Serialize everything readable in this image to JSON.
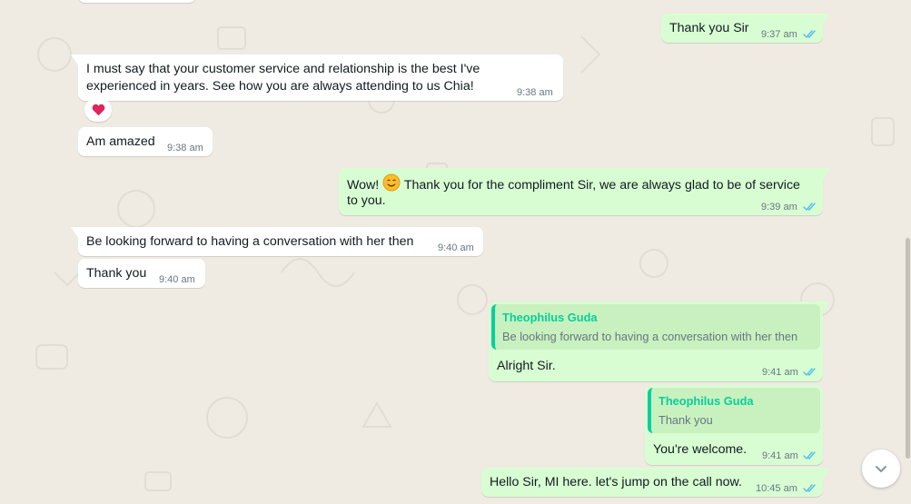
{
  "colors": {
    "chat_background": "#efeae2",
    "incoming_bubble": "#ffffff",
    "outgoing_bubble": "#d9fdd3",
    "quote_background": "#c9f1bf",
    "quote_accent": "#06cf9c",
    "read_ticks": "#53bdeb",
    "timestamp": "#667781",
    "reaction_heart": "#e0245e"
  },
  "messages": [
    {
      "id": "m1",
      "direction": "out",
      "text": "Thank you Sir",
      "time": "9:37 am",
      "status_icon": "double-check-read-icon"
    },
    {
      "id": "m2",
      "direction": "in",
      "text_line1": "I must say that your customer service and relationship is the best I've",
      "text_line2": "experienced in years. See how you are always attending to us Chia!",
      "time": "9:38 am",
      "reaction": "heart-icon"
    },
    {
      "id": "m3",
      "direction": "in",
      "text": "Am amazed",
      "time": "9:38 am"
    },
    {
      "id": "m4",
      "direction": "out",
      "text_before_emoji": "Wow!",
      "emoji_icon": "smiling-face-icon",
      "text_after_emoji": "Thank you for the compliment Sir, we are always glad to be of service",
      "text_line2": "to you.",
      "time": "9:39 am",
      "status_icon": "double-check-read-icon"
    },
    {
      "id": "m5",
      "direction": "in",
      "text": "Be looking forward to having a conversation with her then",
      "time": "9:40 am"
    },
    {
      "id": "m6",
      "direction": "in",
      "text": "Thank you",
      "time": "9:40 am"
    },
    {
      "id": "m7",
      "direction": "out",
      "quote": {
        "author": "Theophilus Guda",
        "text": "Be looking forward to having a conversation with her then"
      },
      "text": "Alright Sir.",
      "time": "9:41 am",
      "status_icon": "double-check-read-icon"
    },
    {
      "id": "m8",
      "direction": "out",
      "quote": {
        "author": "Theophilus Guda",
        "text": "Thank you"
      },
      "text": "You're welcome.",
      "time": "9:41 am",
      "status_icon": "double-check-read-icon"
    },
    {
      "id": "m9",
      "direction": "out",
      "text": "Hello Sir, MI here. let's jump on the call now.",
      "time": "10:45 am",
      "status_icon": "double-check-read-icon"
    }
  ],
  "controls": {
    "scroll_to_bottom_icon": "chevron-down-icon"
  }
}
